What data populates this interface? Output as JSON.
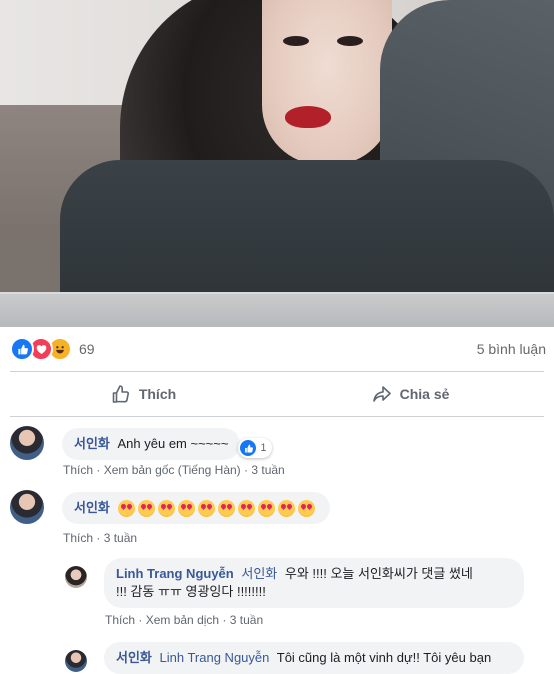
{
  "reactions": {
    "count": "69",
    "comments_label": "5 bình luận"
  },
  "actions": {
    "like": "Thích",
    "share": "Chia sẻ"
  },
  "comments": [
    {
      "author": "서인화",
      "text": "Anh yêu em ~~~~~",
      "reaction_count": "1",
      "meta": {
        "like": "Thích",
        "translate": "Xem bản gốc (Tiếng Hàn)",
        "time": "3 tuần"
      }
    },
    {
      "author": "서인화",
      "emoji_count": 10,
      "meta": {
        "like": "Thích",
        "time": "3 tuần"
      }
    },
    {
      "author": "Linh Trang Nguyễn",
      "mention": "서인화",
      "text_line1": "우와 !!!! 오늘 서인화씨가 댓글 썼네",
      "text_line2": "!!! 감동 ㅠㅠ 영광잉다 !!!!!!!!",
      "meta": {
        "like": "Thích",
        "translate": "Xem bản dịch",
        "time": "3 tuần"
      }
    },
    {
      "author": "서인화",
      "mention": "Linh Trang Nguyễn",
      "text": "Tôi cũng là một vinh dự!! Tôi yêu bạn"
    }
  ],
  "dot": "·"
}
